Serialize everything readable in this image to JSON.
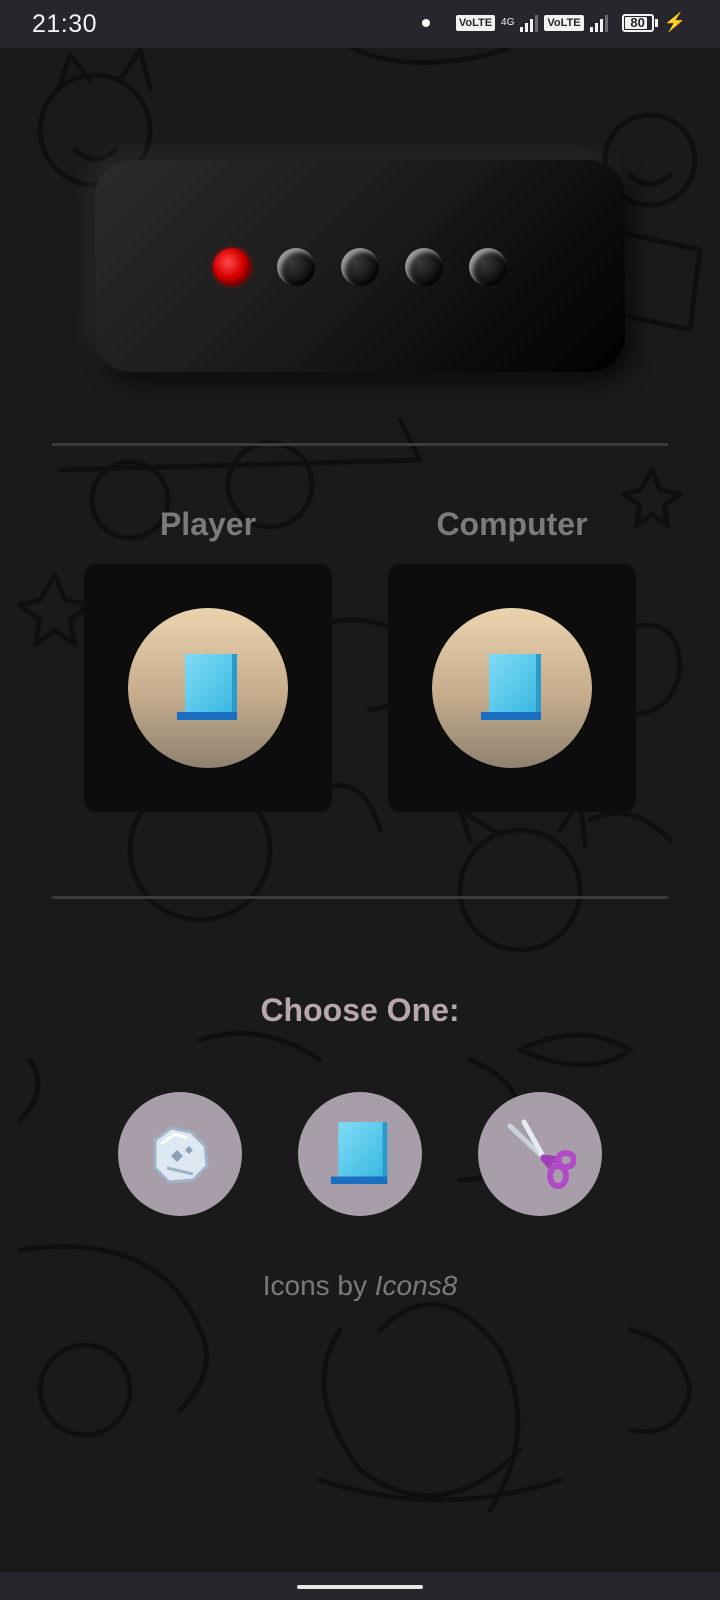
{
  "status_bar": {
    "time": "21:30",
    "volte_1": "VoLTE",
    "network_type": "4G",
    "volte_2": "VoLTE",
    "battery_level": "80"
  },
  "score_panel": {
    "lights_total": 5,
    "lights_lit": 1,
    "lit_color": "#e00000"
  },
  "player": {
    "label": "Player",
    "hand_icon": "paper-icon"
  },
  "computer": {
    "label": "Computer",
    "hand_icon": "paper-icon"
  },
  "chooser": {
    "title": "Choose One:",
    "options": [
      {
        "icon": "rock-icon"
      },
      {
        "icon": "paper-icon"
      },
      {
        "icon": "scissors-icon"
      }
    ]
  },
  "credit": {
    "prefix": "Icons by",
    "brand": "Icons8"
  },
  "colors": {
    "background": "#1a1a1b",
    "label_gray": "#7b7b7d",
    "title_mauve": "#b6a7aa",
    "choice_bg": "#a89ea9"
  }
}
